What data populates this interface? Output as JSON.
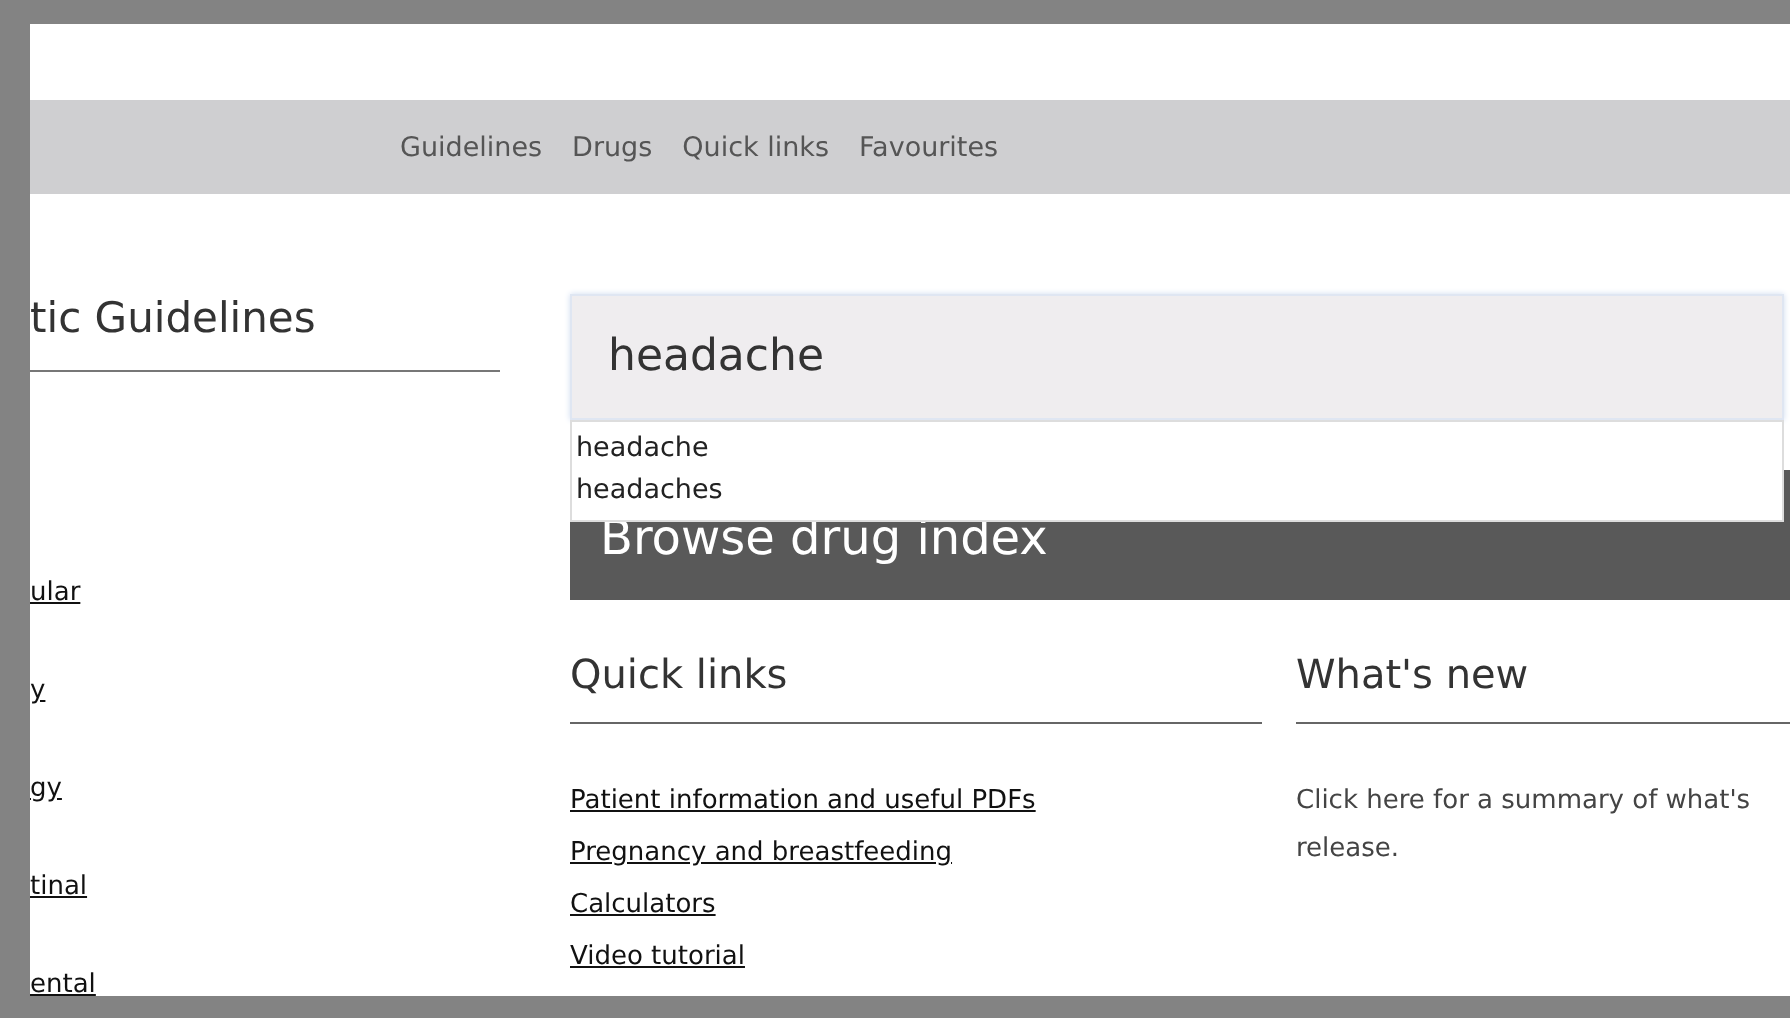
{
  "nav": {
    "items": [
      {
        "label": "Guidelines"
      },
      {
        "label": "Drugs"
      },
      {
        "label": "Quick links"
      },
      {
        "label": "Favourites"
      }
    ]
  },
  "sidebar": {
    "title": "tic Guidelines",
    "items": [
      "ular",
      "y",
      "gy",
      "tinal",
      "ental"
    ]
  },
  "search": {
    "value": "headache",
    "suggestions": [
      "headache",
      "headaches"
    ]
  },
  "browse": {
    "label": "Browse drug index"
  },
  "quick_links": {
    "title": "Quick links",
    "items": [
      "Patient information and useful PDFs",
      "Pregnancy and breastfeeding",
      "Calculators",
      "Video tutorial"
    ]
  },
  "whats_new": {
    "title": "What's new",
    "lines": [
      "Click here for a summary of what's",
      "release."
    ]
  }
}
